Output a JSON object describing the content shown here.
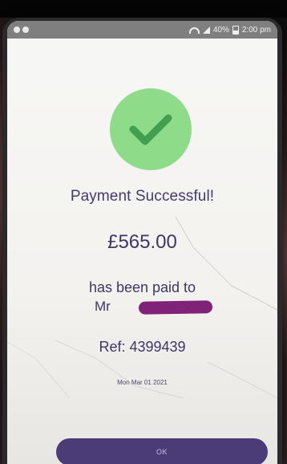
{
  "status_bar": {
    "battery": "40%",
    "time": "2:00 pm",
    "icons": [
      "notification-icon",
      "notification-icon",
      "wifi-icon",
      "signal-icon",
      "battery-icon"
    ]
  },
  "payment": {
    "success_icon": "check-circle-icon",
    "title": "Payment Successful!",
    "amount": "£565.00",
    "paid_to_line": "has been paid to",
    "recipient_prefix": "Mr",
    "reference": "Ref: 4399439",
    "date": "Mon Mar 01 2021",
    "ok_label": "OK"
  },
  "colors": {
    "accent": "#4b3c78",
    "success": "#8edb8a",
    "text": "#3f3566"
  }
}
